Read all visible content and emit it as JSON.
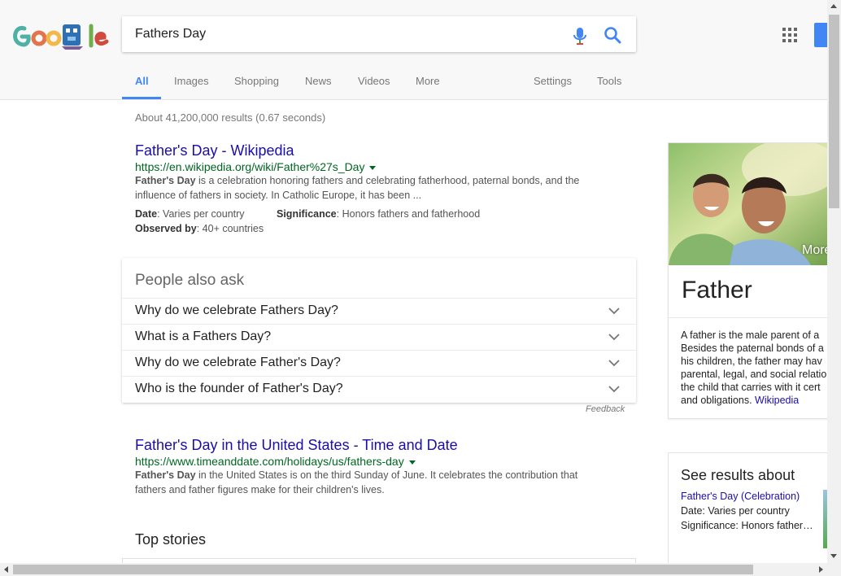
{
  "search": {
    "query": "Fathers Day"
  },
  "tabs": [
    {
      "label": "All"
    },
    {
      "label": "Images"
    },
    {
      "label": "Shopping"
    },
    {
      "label": "News"
    },
    {
      "label": "Videos"
    },
    {
      "label": "More"
    }
  ],
  "tools": {
    "settings": "Settings",
    "tools": "Tools"
  },
  "stats": "About 41,200,000 results (0.67 seconds)",
  "results": [
    {
      "title": "Father's Day - Wikipedia",
      "url": "https://en.wikipedia.org/wiki/Father%27s_Day",
      "snippet_bold": "Father's Day",
      "snippet_line1": " is a celebration honoring fathers and celebrating fatherhood, paternal bonds, and the",
      "snippet_line2": "influence of fathers in society. In Catholic Europe, it has been ...",
      "facts": [
        {
          "label": "Date",
          "value": ": Varies per country"
        },
        {
          "label": "Significance",
          "value": ": Honors fathers and fatherhood"
        },
        {
          "label": "Observed by",
          "value": ": 40+ countries"
        }
      ]
    },
    {
      "title": "Father's Day in the United States - Time and Date",
      "url": "https://www.timeanddate.com/holidays/us/fathers-day",
      "snippet_bold": "Father's Day",
      "snippet_line1": " in the United States is on the third Sunday of June. It celebrates the contribution that",
      "snippet_line2": "fathers and father figures make for their children's lives."
    }
  ],
  "people_also_ask": {
    "heading": "People also ask",
    "questions": [
      "Why do we celebrate Fathers Day?",
      "What is a Fathers Day?",
      "Why do we celebrate Father's Day?",
      "Who is the founder of Father's Day?"
    ],
    "feedback": "Feedback"
  },
  "top_stories": {
    "heading": "Top stories"
  },
  "knowledge_panel": {
    "more_label": "More",
    "title": "Father",
    "desc_lines": [
      "A father is the male parent of a",
      "Besides the paternal bonds of a",
      "his children, the father may hav",
      "parental, legal, and social relatio",
      "the child that carries with it cert",
      "and obligations. "
    ],
    "source_link": "Wikipedia"
  },
  "see_results": {
    "heading": "See results about",
    "link": "Father's Day (Celebration)",
    "facts": [
      "Date: Varies per country",
      "Significance: Honors father…"
    ]
  },
  "colors": {
    "link": "#1a0dab",
    "url_green": "#006621",
    "accent_blue": "#4285f4",
    "header_bg": "#f8f8f8"
  },
  "icons": {
    "logo": "google-doodle-logo",
    "mic": "mic-icon",
    "search": "search-icon",
    "apps": "apps-grid-icon",
    "chevron": "chevron-down-icon"
  }
}
